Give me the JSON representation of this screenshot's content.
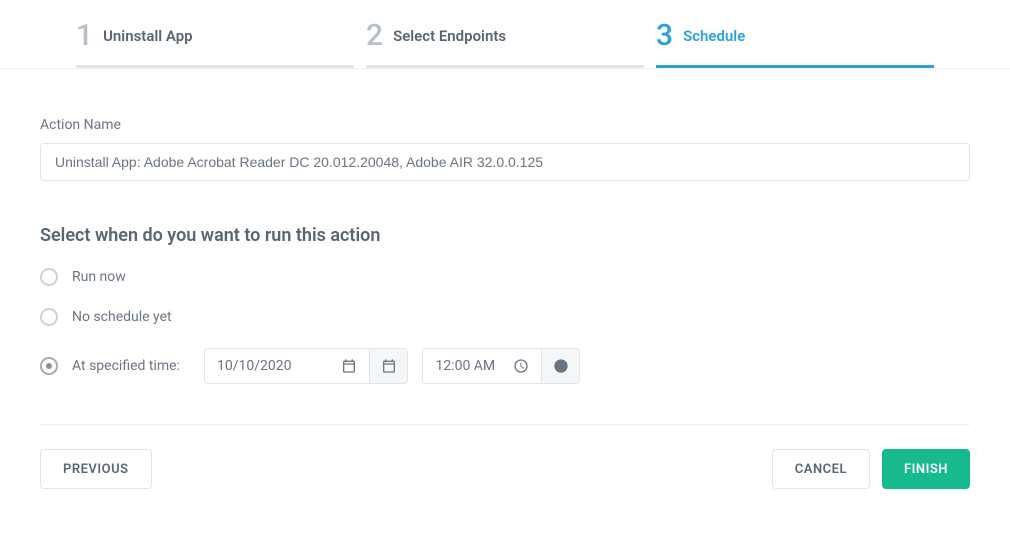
{
  "stepper": {
    "steps": [
      {
        "number": "1",
        "label": "Uninstall App"
      },
      {
        "number": "2",
        "label": "Select Endpoints"
      },
      {
        "number": "3",
        "label": "Schedule"
      }
    ]
  },
  "form": {
    "action_name_label": "Action Name",
    "action_name_value": "Uninstall App: Adobe Acrobat Reader DC 20.012.20048, Adobe AIR 32.0.0.125",
    "section_title": "Select when do you want to run this action",
    "options": {
      "run_now": "Run now",
      "no_schedule": "No schedule yet",
      "at_time": "At specified time:"
    },
    "date_value": "10/10/2020",
    "time_value": "12:00  AM"
  },
  "footer": {
    "previous": "PREVIOUS",
    "cancel": "CANCEL",
    "finish": "FINISH"
  }
}
